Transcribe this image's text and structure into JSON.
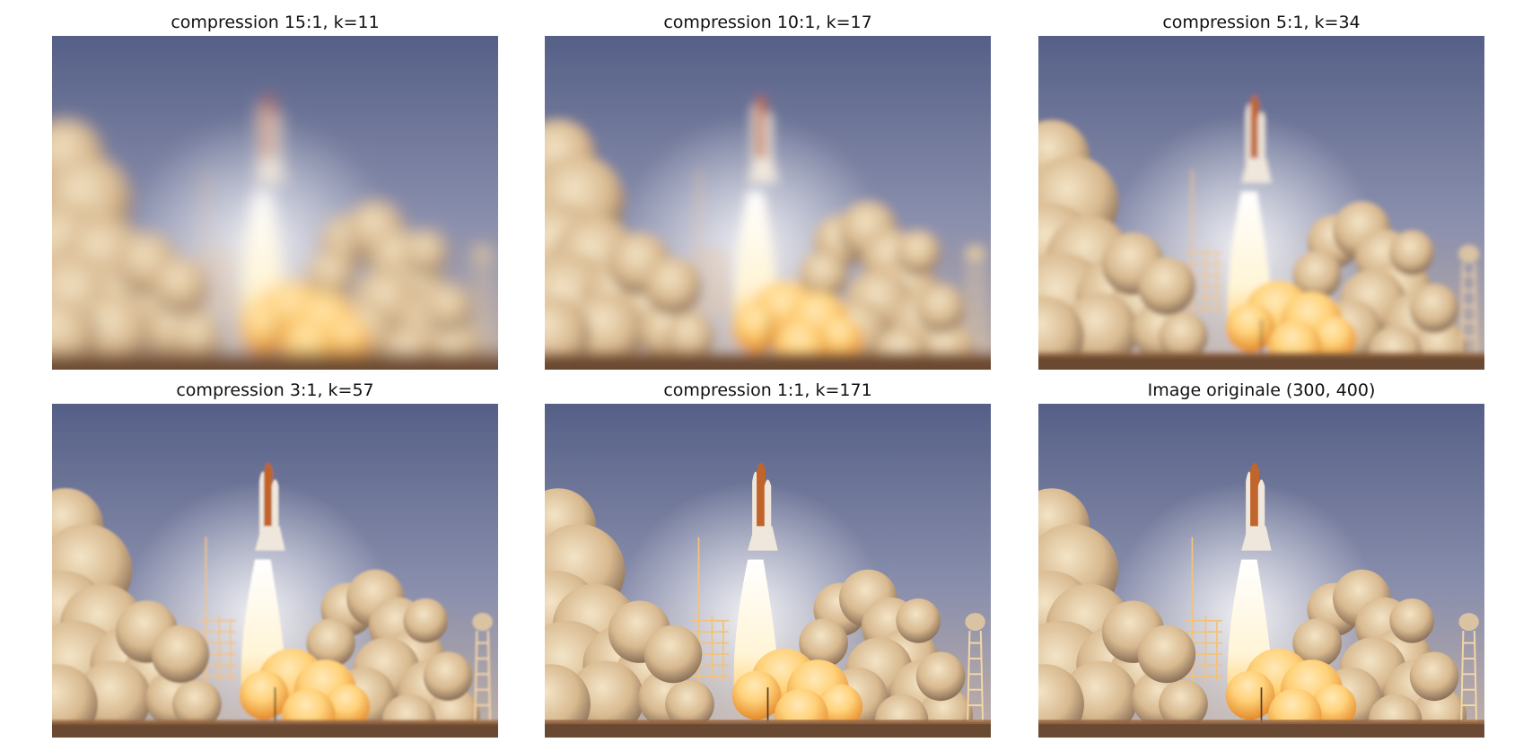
{
  "figure": {
    "panels": [
      {
        "title": "compression 15:1, k=11",
        "blur": 7.5
      },
      {
        "title": "compression 10:1, k=17",
        "blur": 5
      },
      {
        "title": "compression 5:1, k=34",
        "blur": 2.2
      },
      {
        "title": "compression 3:1, k=57",
        "blur": 0.9
      },
      {
        "title": "compression 1:1, k=171",
        "blur": 0.2
      },
      {
        "title": "Image originale (300, 400)",
        "blur": 0
      }
    ],
    "colors": {
      "sky_top": "#4f5a82",
      "sky_mid": "#8a8fad",
      "sky_low": "#c9b6a6",
      "smoke_light": "#f3e4c6",
      "smoke_mid": "#d8b98f",
      "smoke_shadow": "#8a6f57",
      "flame_core": "#ffffff",
      "flame_glow": "#ffd27a",
      "fireball": "#e58a2a",
      "ground": "#6b4a33",
      "orbiter": "#efe7dc",
      "tank": "#c0652b"
    }
  }
}
